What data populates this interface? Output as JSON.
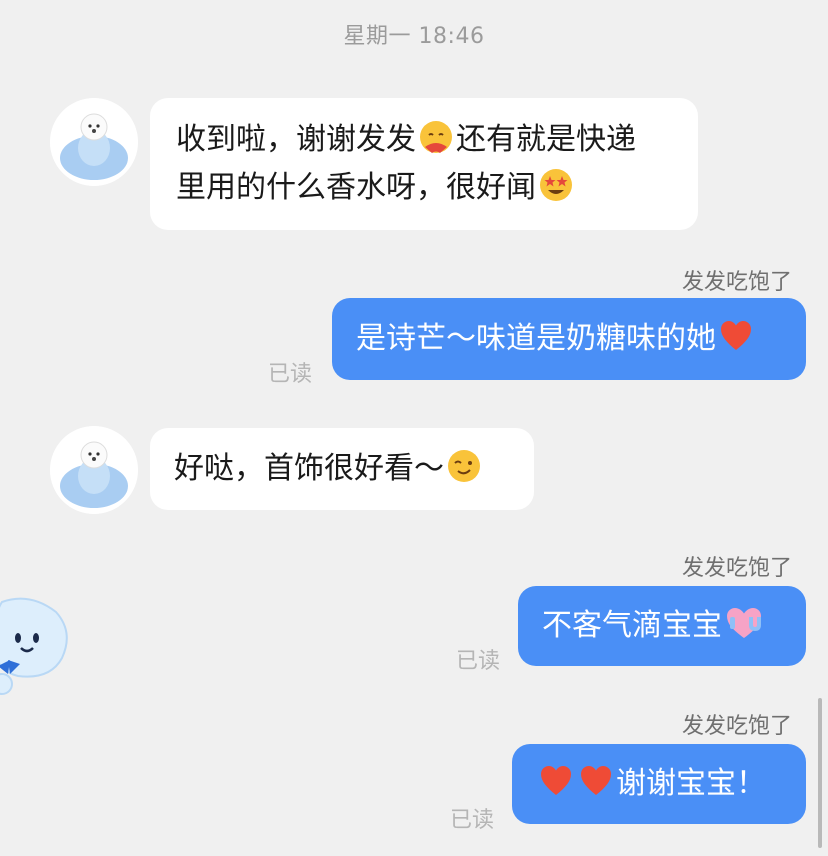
{
  "chat": {
    "timestamp": "星期一 18:46",
    "sender_name": "发发吃饱了",
    "read_label": "已读",
    "messages": [
      {
        "direction": "incoming",
        "lines": [
          [
            "收到啦，谢谢发发",
            "还有就是快递"
          ],
          [
            "里用的什么香水呀，很好闻",
            ""
          ]
        ],
        "emojis": [
          "hugging-face-emoji",
          "star-struck-emoji"
        ]
      },
      {
        "direction": "outgoing",
        "sender": "发发吃饱了",
        "read": "已读",
        "text": "是诗芒～味道是奶糖味的她",
        "emojis": [
          "red-heart-emoji"
        ]
      },
      {
        "direction": "incoming",
        "text": "好哒，首饰很好看～",
        "emojis": [
          "winking-face-emoji"
        ]
      },
      {
        "direction": "outgoing",
        "sender": "发发吃饱了",
        "read": "已读",
        "text": "不客气滴宝宝",
        "emojis": [
          "i-love-you-heart-emoji"
        ]
      },
      {
        "direction": "outgoing",
        "sender": "发发吃饱了",
        "read": "已读",
        "text": "谢谢宝宝！",
        "emojis": [
          "red-heart-emoji",
          "red-heart-emoji"
        ]
      }
    ]
  },
  "colors": {
    "background": "#f0f0f0",
    "incoming_bubble": "#ffffff",
    "outgoing_bubble": "#4a8ff6",
    "timestamp_text": "#9b9b9b",
    "read_text": "#b5b5b5"
  }
}
